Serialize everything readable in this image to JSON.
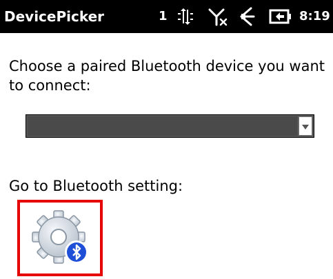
{
  "titlebar": {
    "title": "DevicePicker",
    "notification_count": "1",
    "clock": "8:19",
    "icons": [
      "data-sync-icon",
      "signal-off-icon",
      "speaker-icon",
      "battery-charging-icon"
    ]
  },
  "main": {
    "prompt": "Choose a paired Bluetooth device you want to connect:",
    "device_combo": {
      "selected_value": "",
      "dropdown_icon": "chevron-down-icon"
    },
    "goto_label": "Go to Bluetooth setting:",
    "settings_button": {
      "icon": "bluetooth-settings-gear-icon",
      "highlight_color": "#e60000"
    }
  },
  "colors": {
    "titlebar_bg": "#000000",
    "combo_bg": "#4a4a4a",
    "bluetooth_badge": "#1f4fd6"
  }
}
